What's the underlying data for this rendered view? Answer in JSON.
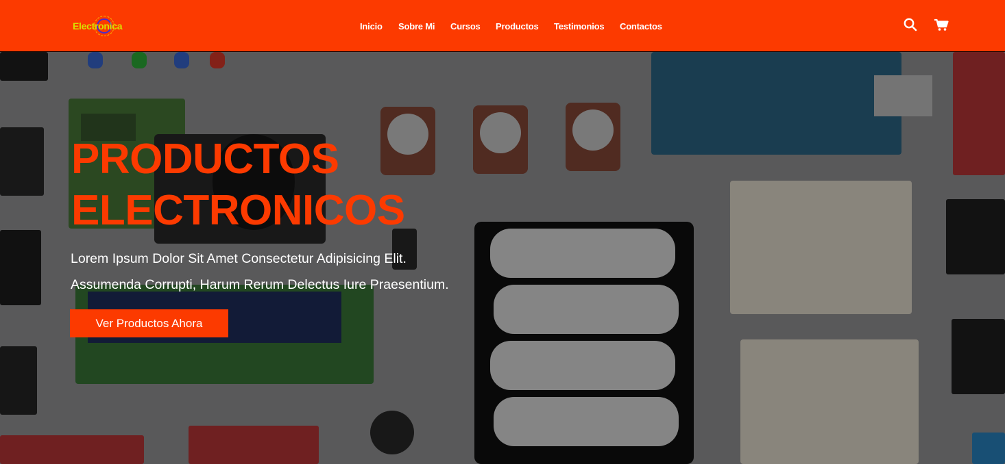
{
  "brand": {
    "logo_text": "Electronica"
  },
  "nav": {
    "items": [
      {
        "label": "Inicio"
      },
      {
        "label": "Sobre Mi"
      },
      {
        "label": "Cursos"
      },
      {
        "label": "Productos"
      },
      {
        "label": "Testimonios"
      },
      {
        "label": "Contactos"
      }
    ]
  },
  "header_icons": {
    "search": "search-icon",
    "cart": "cart-icon"
  },
  "hero": {
    "title_line1": "PRODUCTOS",
    "title_line2": "ELECTRONICOS",
    "subtitle_line1": "Lorem Ipsum Dolor Sit Amet Consectetur Adipisicing Elit.",
    "subtitle_line2": "Assumenda Corrupti, Harum Rerum Delectus Iure Praesentium.",
    "cta_label": "Ver Productos Ahora"
  },
  "colors": {
    "brand_orange": "#fc3a00",
    "logo_yellow": "#d9e000",
    "text_white": "#ffffff"
  }
}
